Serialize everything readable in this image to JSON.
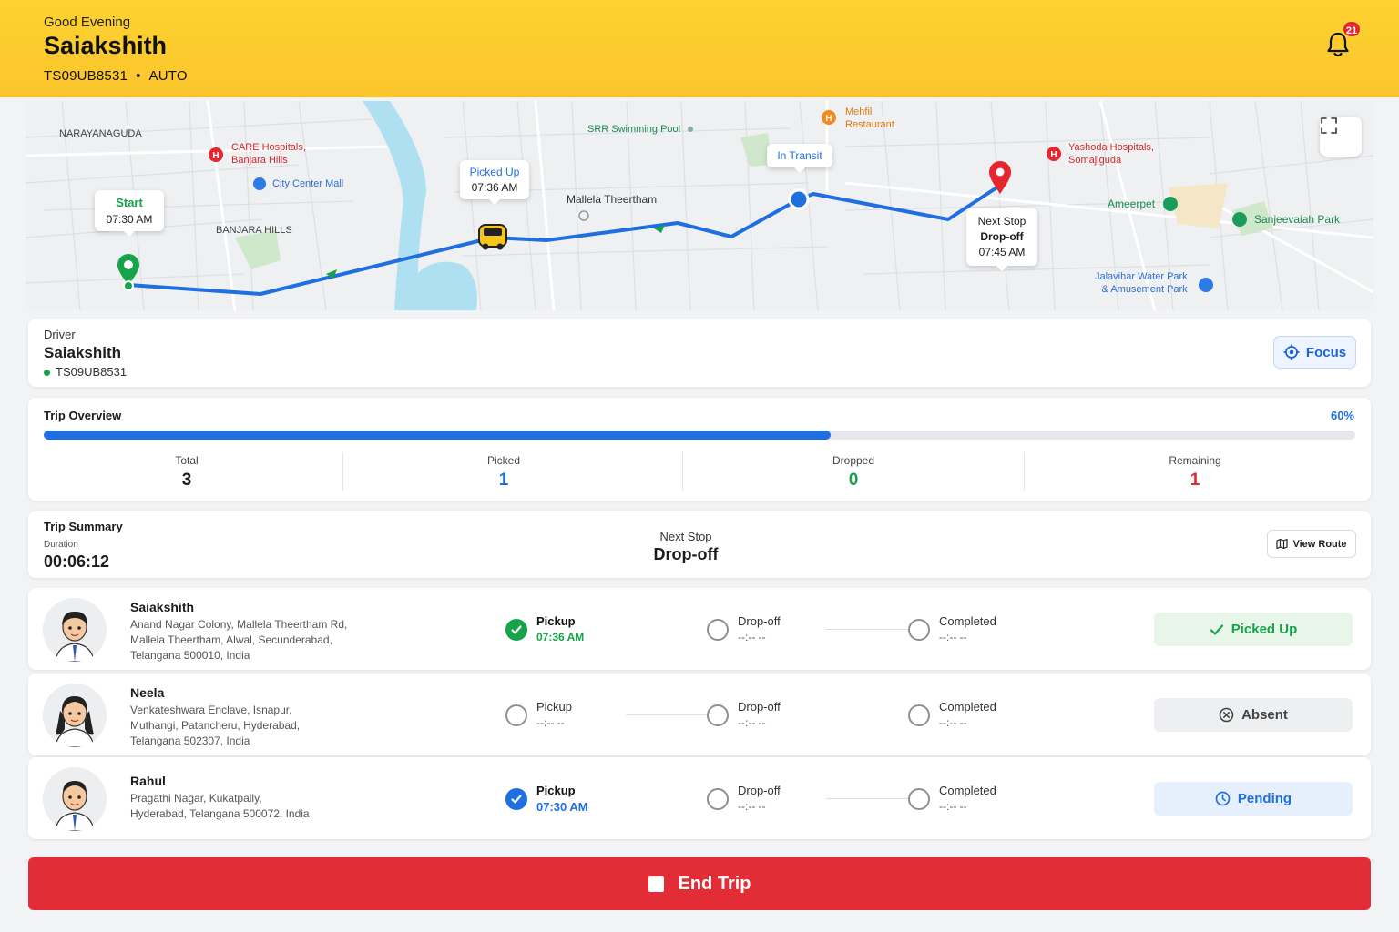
{
  "header": {
    "greeting": "Good Evening",
    "name": "Saiakshith",
    "vehicle": "TS09UB8531",
    "vehicle_type": "AUTO",
    "notification_count": "21"
  },
  "map": {
    "places": {
      "narayanaguda": "NARAYANAGUDA",
      "care_hospitals_1": "CARE Hospitals,",
      "care_hospitals_2": "Banjara Hills",
      "city_center_mall": "City Center Mall",
      "banjara_hills": "BANJARA HILLS",
      "srr_pool": "SRR Swimming Pool",
      "mallela": "Mallela Theertham",
      "mehfil_1": "Mehfil",
      "mehfil_2": "Restaurant",
      "yashoda_1": "Yashoda Hospitals,",
      "yashoda_2": "Somajiguda",
      "ameerpet": "Ameerpet",
      "sanjeevaiah": "Sanjeevaiah Park",
      "jalavihar_1": "Jalavihar Water Park",
      "jalavihar_2": "& Amusement Park"
    },
    "start": {
      "label": "Start",
      "time": "07:30 AM"
    },
    "picked_up": {
      "label": "Picked Up",
      "time": "07:36 AM"
    },
    "in_transit": {
      "label": "In Transit"
    },
    "next_stop": {
      "label": "Next Stop",
      "stop": "Drop-off",
      "time": "07:45 AM"
    },
    "colors": {
      "route": "#1e6fe0",
      "start_pin": "#16a34a",
      "dest_pin": "#e5252f"
    }
  },
  "driver": {
    "label": "Driver",
    "name": "Saiakshith",
    "plate": "TS09UB8531",
    "focus_label": "Focus"
  },
  "overview": {
    "title": "Trip Overview",
    "progress_label": "60%",
    "progress": 0.6,
    "stats": [
      {
        "label": "Total",
        "value": "3",
        "color": "#1c1c1e"
      },
      {
        "label": "Picked",
        "value": "1",
        "color": "#1e6fe0"
      },
      {
        "label": "Dropped",
        "value": "0",
        "color": "#16a34a"
      },
      {
        "label": "Remaining",
        "value": "1",
        "color": "#e5252f"
      }
    ]
  },
  "summary": {
    "title": "Trip Summary",
    "duration_label": "Duration",
    "duration": "00:06:12",
    "next_stop_label": "Next Stop",
    "next_stop": "Drop-off",
    "view_route_label": "View Route"
  },
  "students": [
    {
      "name": "Saiakshith",
      "address": [
        "Anand Nagar Colony, Mallela Theertham Rd,",
        "Mallela Theertham, Alwal, Secunderabad,",
        "Telangana 500010, India"
      ],
      "steps": [
        {
          "label": "Pickup",
          "time": "07:36 AM"
        },
        {
          "label": "Drop-off",
          "time": "--:--  --"
        },
        {
          "label": "Completed",
          "time": "--:--  --"
        }
      ],
      "status": "Picked Up"
    },
    {
      "name": "Neela",
      "address": [
        "Venkateshwara Enclave, Isnapur,",
        "Muthangi, Patancheru, Hyderabad,",
        "Telangana 502307, India"
      ],
      "steps": [
        {
          "label": "Pickup",
          "time": "--:--  --"
        },
        {
          "label": "Drop-off",
          "time": "--:--  --"
        },
        {
          "label": "Completed",
          "time": "--:--  --"
        }
      ],
      "status": "Absent"
    },
    {
      "name": "Rahul",
      "address": [
        "Pragathi Nagar, Kukatpally,",
        "Hyderabad, Telangana 500072, India"
      ],
      "steps": [
        {
          "label": "Pickup",
          "time": "07:30 AM"
        },
        {
          "label": "Drop-off",
          "time": "--:--  --"
        },
        {
          "label": "Completed",
          "time": "--:--  --"
        }
      ],
      "status": "Pending"
    }
  ],
  "end_trip_label": "End Trip"
}
